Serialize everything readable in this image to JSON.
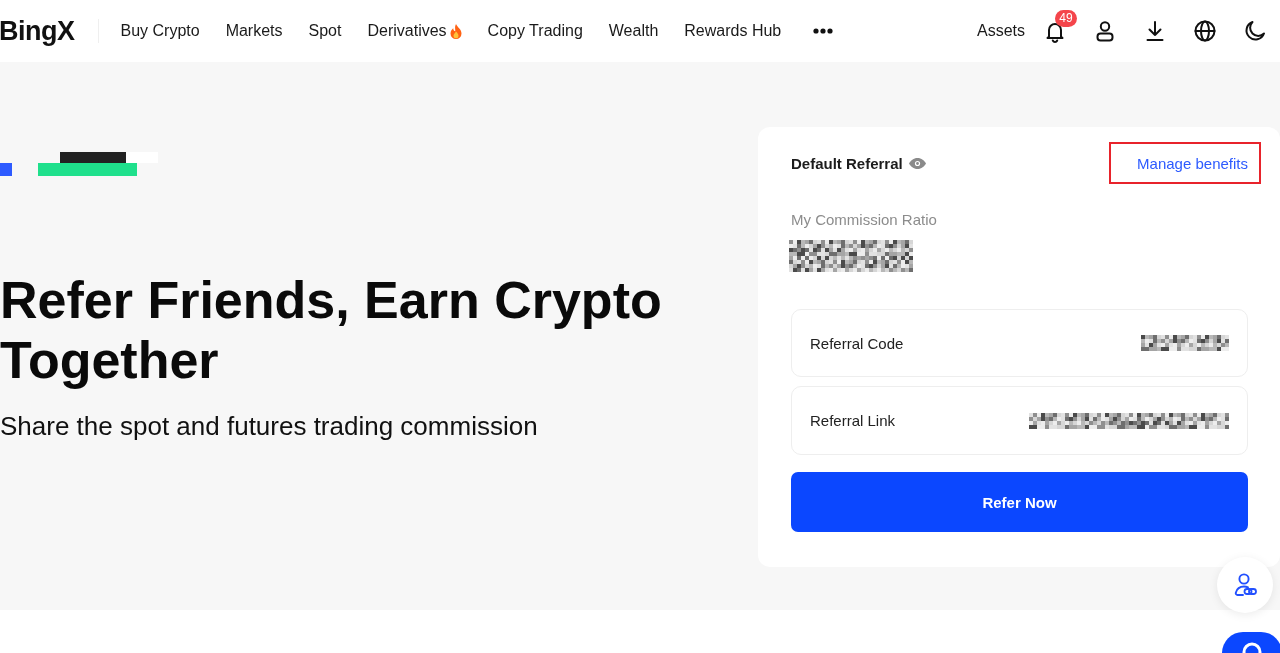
{
  "header": {
    "logo": "BingX",
    "nav_items": [
      {
        "label": "Buy Crypto",
        "hot": false
      },
      {
        "label": "Markets",
        "hot": false
      },
      {
        "label": "Spot",
        "hot": false
      },
      {
        "label": "Derivatives",
        "hot": true
      },
      {
        "label": "Copy Trading",
        "hot": false
      },
      {
        "label": "Wealth",
        "hot": false
      },
      {
        "label": "Rewards Hub",
        "hot": false
      }
    ],
    "assets_label": "Assets",
    "notification_count": "49"
  },
  "hero": {
    "title": "Refer Friends, Earn Crypto Together",
    "subtitle": "Share the spot and futures trading commission"
  },
  "referral_card": {
    "title": "Default Referral",
    "manage_link": {
      "label": "Manage benefits",
      "highlighted": true
    },
    "commission_label": "My Commission Ratio",
    "commission_redacted": true,
    "fields": [
      {
        "label": "Referral Code",
        "redacted": true
      },
      {
        "label": "Referral Link",
        "redacted": true
      }
    ],
    "button": "Refer Now"
  }
}
